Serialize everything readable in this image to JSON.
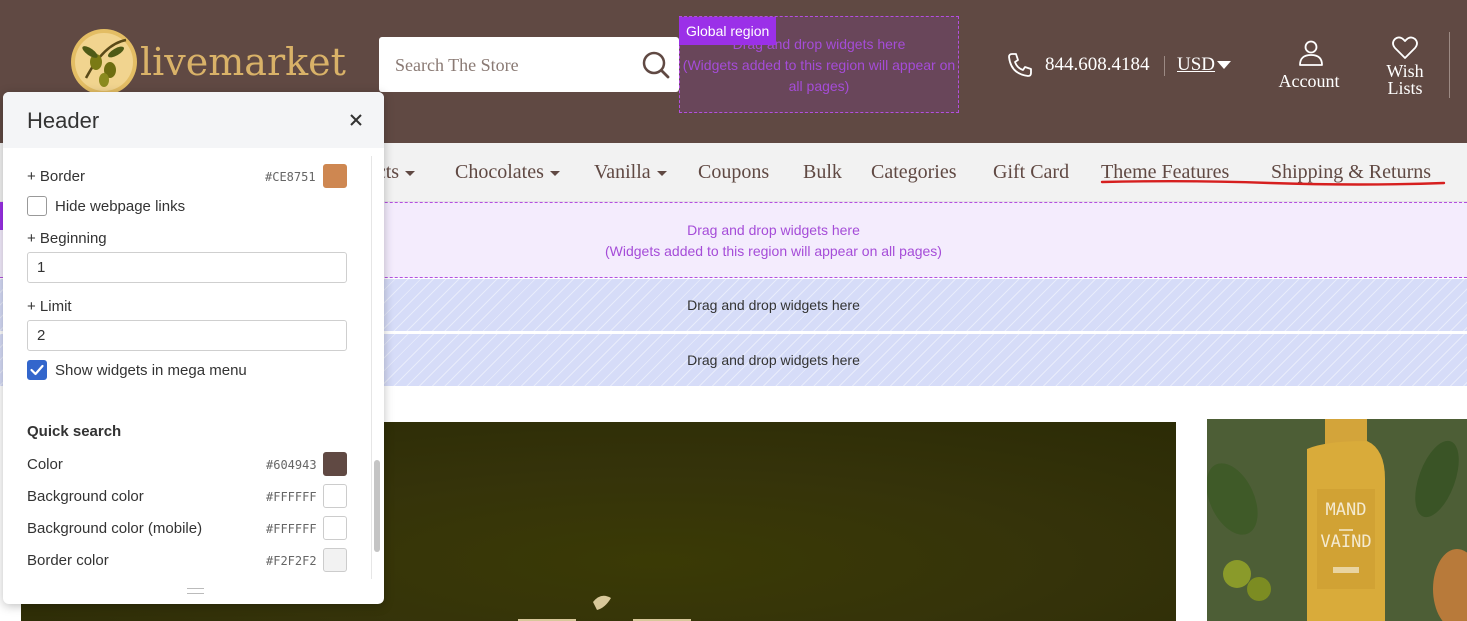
{
  "header": {
    "logo_text": "livemarket",
    "search_placeholder": "Search The Store",
    "phone": "844.608.4184",
    "currency": "USD",
    "account_label": "Account",
    "wish_label_line1": "Wish",
    "wish_label_line2": "Lists",
    "bg_color": "#604943"
  },
  "global_region": {
    "label": "Global region",
    "text_line1": "Drag and drop widgets here",
    "text_line2": "(Widgets added to this region will appear on",
    "text_line3": "all pages)"
  },
  "nav": {
    "items": [
      {
        "label": "acts",
        "caret": true
      },
      {
        "label": "Chocolates",
        "caret": true
      },
      {
        "label": "Vanilla",
        "caret": true
      },
      {
        "label": "Coupons",
        "caret": false
      },
      {
        "label": "Bulk",
        "caret": false
      },
      {
        "label": "Categories",
        "caret": false
      },
      {
        "label": "Gift Card",
        "caret": false
      },
      {
        "label": "Theme Features",
        "caret": false
      },
      {
        "label": "Shipping & Returns",
        "caret": false
      }
    ]
  },
  "regions": {
    "purple_line1": "Drag and drop widgets here",
    "purple_line2": "(Widgets added to this region will appear on all pages)",
    "striped_1": "Drag and drop widgets here",
    "striped_2": "Drag and drop widgets here"
  },
  "hero_right": {
    "bottle_line1": "MAND",
    "bottle_line2": "VAIND"
  },
  "panel": {
    "title": "Header",
    "border_label": "+ Border",
    "border_hex": "#CE8751",
    "hide_links_label": "Hide webpage links",
    "hide_links_checked": false,
    "beginning_label": "+ Beginning",
    "beginning_value": "1",
    "limit_label": "+ Limit",
    "limit_value": "2",
    "show_widgets_label": "Show widgets in mega menu",
    "show_widgets_checked": true,
    "quick_search_title": "Quick search",
    "color_label": "Color",
    "color_hex": "#604943",
    "bg_label": "Background color",
    "bg_hex": "#FFFFFF",
    "bg_mobile_label": "Background color (mobile)",
    "bg_mobile_hex": "#FFFFFF",
    "border_color_label": "Border color",
    "border_color_hex": "#F2F2F2"
  }
}
